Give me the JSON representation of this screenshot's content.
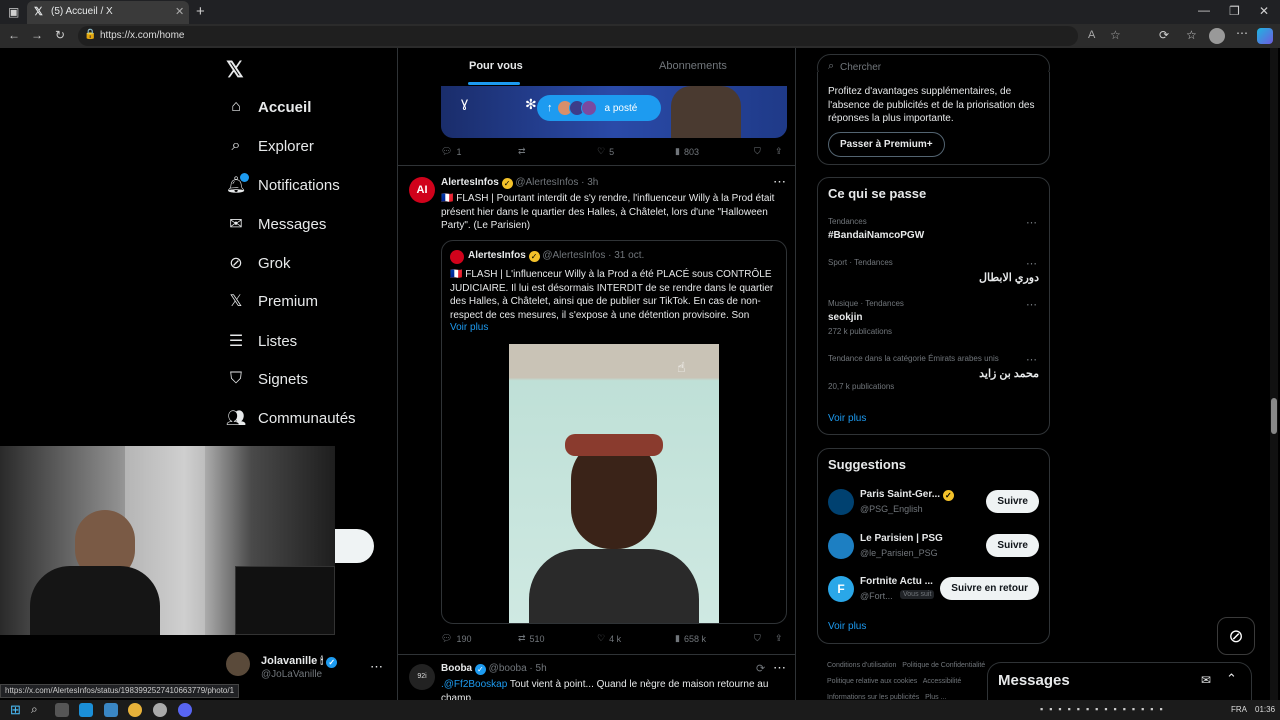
{
  "browser": {
    "tab_title": "(5) Accueil / X",
    "url": "https://x.com/home",
    "status_url": "https://x.com/AlertesInfos/status/1983992527410663779/photo/1"
  },
  "nav": {
    "items": [
      {
        "label": "Accueil",
        "icon": "home-icon"
      },
      {
        "label": "Explorer",
        "icon": "search-icon"
      },
      {
        "label": "Notifications",
        "icon": "bell-icon"
      },
      {
        "label": "Messages",
        "icon": "mail-icon"
      },
      {
        "label": "Grok",
        "icon": "grok-icon"
      },
      {
        "label": "Premium",
        "icon": "x-logo-icon"
      },
      {
        "label": "Listes",
        "icon": "list-icon"
      },
      {
        "label": "Signets",
        "icon": "bookmark-icon"
      },
      {
        "label": "Communautés",
        "icon": "people-icon"
      }
    ],
    "account_name": "Jolavanille",
    "account_handle": "@JoLaVanille"
  },
  "feed": {
    "tabs": [
      "Pour vous",
      "Abonnements"
    ],
    "reposted_label": "a posté",
    "prev_post_stats": {
      "replies": "1",
      "reposts": "",
      "likes": "5",
      "views": "803"
    },
    "post1": {
      "name": "AlertesInfos",
      "handle": "@AlertesInfos",
      "time": "3h",
      "text": "🇫🇷 FLASH | Pourtant interdit de s'y rendre, l'influenceur Willy à la Prod était présent hier dans le quartier des Halles, à Châtelet, lors d'une \"Halloween Party\". (Le Parisien)",
      "quote": {
        "name": "AlertesInfos",
        "handle": "@AlertesInfos",
        "time": "31 oct.",
        "text": "🇫🇷 FLASH | L'influenceur Willy à la Prod a été PLACÉ sous CONTRÔLE JUDICIAIRE. Il lui est désormais INTERDIT de se rendre dans le quartier des Halles, à Châtelet, ainsi que de publier sur TikTok. En cas de non-respect de ces mesures, il s'expose à une détention provisoire. Son",
        "more": "Voir plus"
      },
      "stats": {
        "replies": "190",
        "reposts": "510",
        "likes": "4 k",
        "views": "658 k"
      }
    },
    "post2": {
      "name": "Booba",
      "handle": "@booba",
      "time": "5h",
      "mention": ".@Ff2Booskap",
      "text": "Tout vient à point... Quand le nègre de maison retourne au champ."
    }
  },
  "right": {
    "search_placeholder": "Chercher",
    "premium": {
      "text": "Profitez d'avantages supplémentaires, de l'absence de publicités et de la priorisation des réponses la plus importante.",
      "button": "Passer à Premium+"
    },
    "trends": {
      "title": "Ce qui se passe",
      "items": [
        {
          "context": "Tendances",
          "name": "#BandaiNamcoPGW",
          "count": ""
        },
        {
          "context": "Sport · Tendances",
          "name": "دوري الابطال",
          "count": ""
        },
        {
          "context": "Musique · Tendances",
          "name": "seokjin",
          "count": "272 k publications"
        },
        {
          "context": "Tendance dans la catégorie Émirats arabes unis",
          "name": "محمد بن زايد",
          "count": "20,7 k publications"
        }
      ],
      "more": "Voir plus"
    },
    "suggestions": {
      "title": "Suggestions",
      "items": [
        {
          "name": "Paris Saint-Ger...",
          "handle": "@PSG_English",
          "button": "Suivre"
        },
        {
          "name": "Le Parisien | PSG",
          "handle": "@le_Parisien_PSG",
          "button": "Suivre"
        },
        {
          "name": "Fortnite Actu ...",
          "handle": "@Fort...",
          "badge": "Vous suit",
          "button": "Suivre en retour"
        }
      ],
      "more": "Voir plus"
    },
    "footer": [
      "Conditions d'utilisation",
      "Politique de Confidentialité",
      "Politique relative aux cookies",
      "Accessibilité",
      "Informations sur les publicités",
      "Plus ..."
    ]
  },
  "messages_drawer": {
    "title": "Messages"
  },
  "taskbar": {
    "language": "FRA",
    "time": "01:36"
  }
}
